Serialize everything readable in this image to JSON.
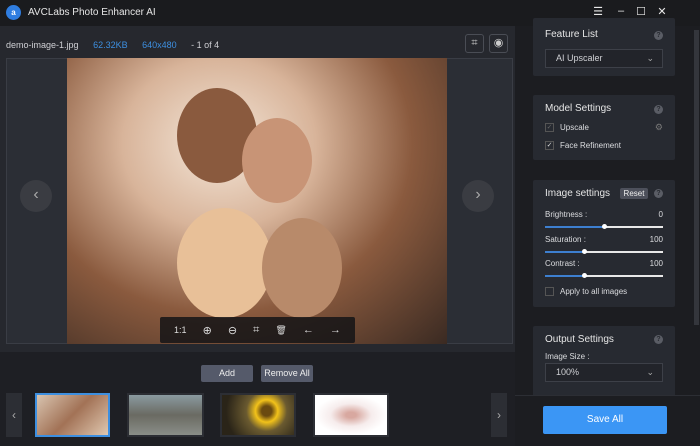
{
  "app": {
    "title": "AVCLabs Photo Enhancer AI",
    "logo": "a"
  },
  "window_controls": {
    "menu": "☰",
    "minimize": "–",
    "maximize": "☐",
    "close": "✕"
  },
  "file": {
    "name": "demo-image-1.jpg",
    "size": "62.32KB",
    "dimensions": "640x480",
    "position": "- 1 of 4"
  },
  "viewer_toolbar": {
    "ratio": "1:1",
    "zoom_in": "⊕",
    "zoom_out": "⊖",
    "crop": "⌗",
    "delete": "🗑",
    "prev": "←",
    "next": "→"
  },
  "nav": {
    "prev": "‹",
    "next": "›"
  },
  "bottom": {
    "add": "Add",
    "remove_all": "Remove All"
  },
  "thumbnails": [
    {
      "name": "selfie",
      "selected": true
    },
    {
      "name": "city"
    },
    {
      "name": "sunflower"
    },
    {
      "name": "anime"
    }
  ],
  "feature_list": {
    "title": "Feature List",
    "selected": "AI Upscaler"
  },
  "model_settings": {
    "title": "Model Settings",
    "upscale": "Upscale",
    "face_refinement": "Face Refinement"
  },
  "image_settings": {
    "title": "Image settings",
    "reset": "Reset",
    "brightness": {
      "label": "Brightness :",
      "value": "0",
      "fraction": 0.5
    },
    "saturation": {
      "label": "Saturation :",
      "value": "100",
      "fraction": 0.33
    },
    "contrast": {
      "label": "Contrast :",
      "value": "100",
      "fraction": 0.33
    },
    "apply_all": "Apply to all images"
  },
  "output_settings": {
    "title": "Output Settings",
    "size_label": "Image Size :",
    "size": "100%"
  },
  "save_all": "Save All",
  "help": "?"
}
